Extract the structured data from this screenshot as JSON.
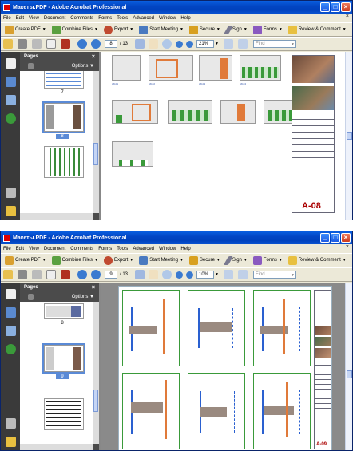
{
  "app": {
    "title": "Макеты.PDF - Adobe Acrobat Professional",
    "menu": [
      "File",
      "Edit",
      "View",
      "Document",
      "Comments",
      "Forms",
      "Tools",
      "Advanced",
      "Window",
      "Help"
    ],
    "toolbar": {
      "create_pdf": "Create PDF",
      "combine_files": "Combine Files",
      "export": "Export",
      "start_meeting": "Start Meeting",
      "secure": "Secure",
      "sign": "Sign",
      "forms": "Forms",
      "review_comment": "Review & Comment"
    },
    "find_placeholder": "Find",
    "panel_title": "Pages",
    "panel_options": "Options"
  },
  "windows": [
    {
      "page_number": "8",
      "page_total": "/ 13",
      "zoom": "21%",
      "thumbnails": [
        "7",
        "8"
      ],
      "selected_thumb": "8",
      "sheet_code": "A-08"
    },
    {
      "page_number": "9",
      "page_total": "/ 13",
      "zoom": "10%",
      "thumbnails": [
        "8",
        "9"
      ],
      "selected_thumb": "9",
      "sheet_code": "A-09"
    }
  ],
  "colors": {
    "titlebar": "#0346c4",
    "nav_panel": "#4b4b4b",
    "selection": "#5a8ad6",
    "drawing_orange": "#e07a3a",
    "drawing_green": "#3a9a3a",
    "drawing_blue": "#2a60d0",
    "drawing_red": "#a00000"
  }
}
